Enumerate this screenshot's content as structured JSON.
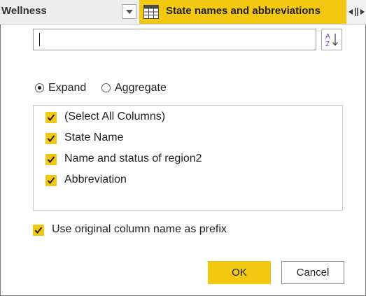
{
  "header": {
    "left_label": "Wellness",
    "right_label": "State names and abbreviations",
    "accent_color": "#f2c811"
  },
  "search": {
    "value": "",
    "placeholder": ""
  },
  "mode_options": [
    {
      "label": "Expand",
      "selected": true
    },
    {
      "label": "Aggregate",
      "selected": false
    }
  ],
  "columns": [
    {
      "label": "(Select All Columns)",
      "checked": true
    },
    {
      "label": "State Name",
      "checked": true
    },
    {
      "label": "Name and status of region2",
      "checked": true
    },
    {
      "label": "Abbreviation",
      "checked": true
    }
  ],
  "prefix_option": {
    "label": "Use original column name as prefix",
    "checked": true
  },
  "buttons": {
    "ok": "OK",
    "cancel": "Cancel"
  },
  "icons": [
    "table-icon",
    "dropdown-arrow-icon",
    "expand-column-icon",
    "sort-az-icon",
    "checkmark-icon"
  ]
}
